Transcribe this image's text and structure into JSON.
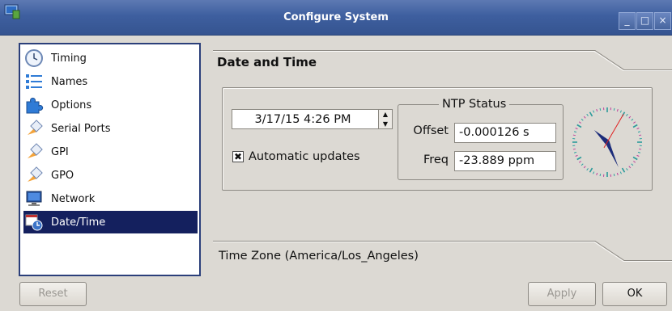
{
  "window": {
    "title": "Configure System",
    "controls": [
      "_",
      "□",
      "×"
    ]
  },
  "sidebar": {
    "items": [
      {
        "label": "Timing",
        "icon": "clock-icon",
        "selected": false
      },
      {
        "label": "Names",
        "icon": "list-icon",
        "selected": false
      },
      {
        "label": "Options",
        "icon": "puzzle-icon",
        "selected": false
      },
      {
        "label": "Serial Ports",
        "icon": "plug-icon",
        "selected": false
      },
      {
        "label": "GPI",
        "icon": "plug-icon",
        "selected": false
      },
      {
        "label": "GPO",
        "icon": "plug-icon",
        "selected": false
      },
      {
        "label": "Network",
        "icon": "monitor-icon",
        "selected": false
      },
      {
        "label": "Date/Time",
        "icon": "calendar-clock-icon",
        "selected": true
      }
    ]
  },
  "main": {
    "section_title": "Date and Time",
    "datetime_value": "3/17/15 4:26 PM",
    "auto_updates": {
      "label": "Automatic updates",
      "checked": true
    },
    "ntp": {
      "title": "NTP Status",
      "offset_label": "Offset",
      "offset_value": "-0.000126 s",
      "freq_label": "Freq",
      "freq_value": "-23.889 ppm"
    },
    "timezone_label": "Time Zone  (America/Los_Angeles)"
  },
  "buttons": {
    "reset": "Reset",
    "apply": "Apply",
    "ok": "OK"
  },
  "colors": {
    "titlebar": "#3e5f9f",
    "selection": "#14205e",
    "background": "#dcd9d3"
  }
}
